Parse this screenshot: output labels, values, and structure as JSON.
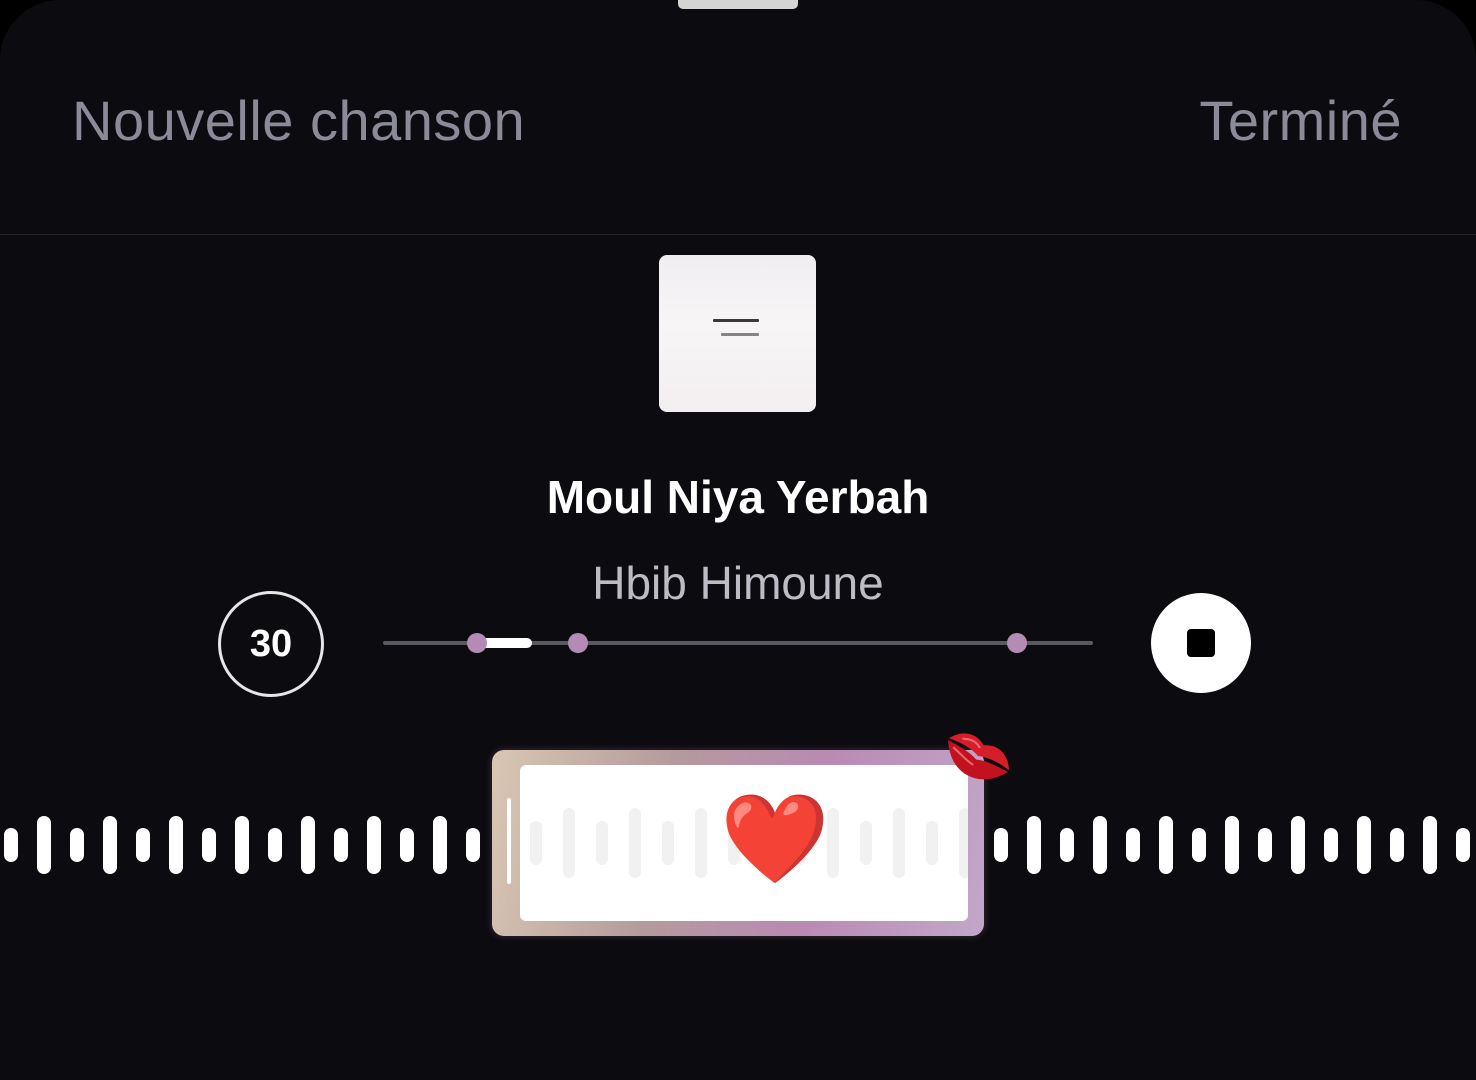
{
  "header": {
    "left_label": "Nouvelle chanson",
    "right_label": "Terminé"
  },
  "song": {
    "title": "Moul Niya Yerbah",
    "artist": "Hbib Himoune"
  },
  "controls": {
    "duration_label": "30",
    "progress_fraction": 0.08
  },
  "colors": {
    "background": "#0c0b0f",
    "header_text": "#8b8a98",
    "accent_marker": "#b48bb4"
  },
  "icons": {
    "stop": "stop-icon",
    "heart": "heart-emoji",
    "lips": "kiss-mark-emoji"
  }
}
